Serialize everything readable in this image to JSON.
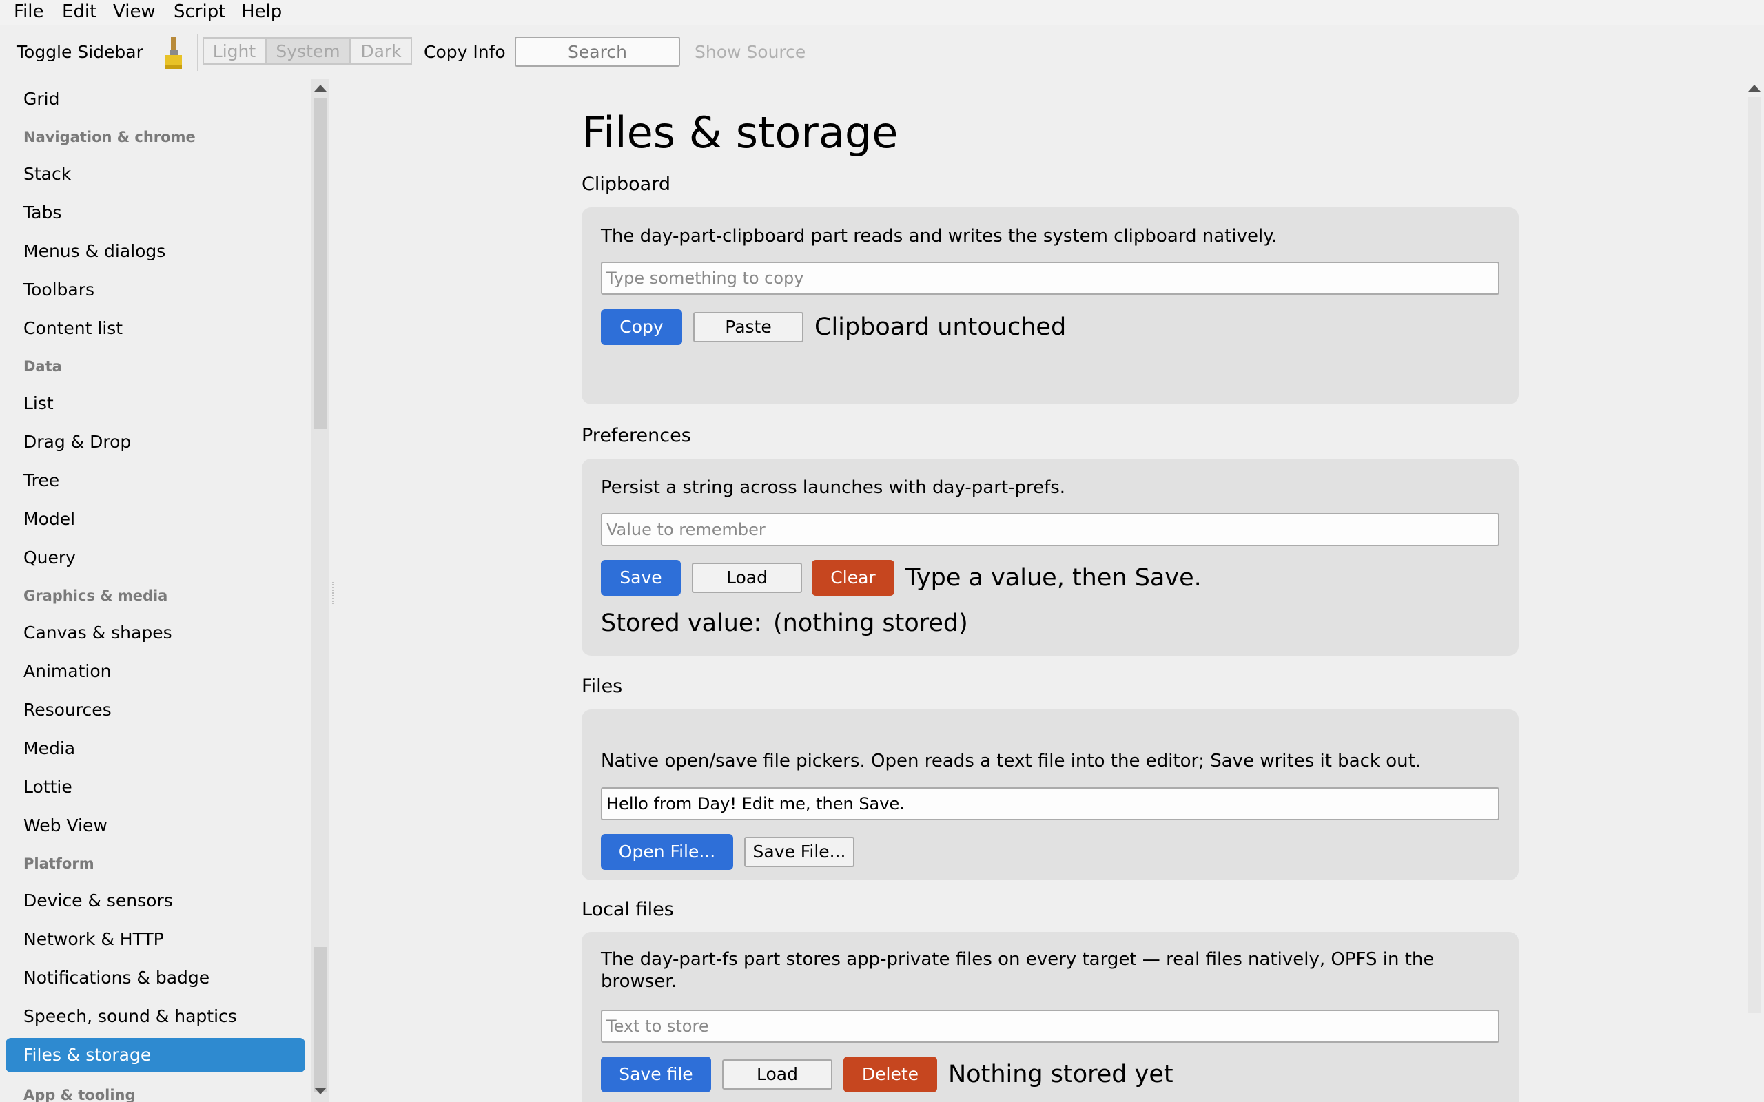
{
  "menubar": {
    "items": [
      "File",
      "Edit",
      "View",
      "Script",
      "Help"
    ]
  },
  "toolbar": {
    "toggle_sidebar": "Toggle Sidebar",
    "theme_light": "Light",
    "theme_system": "System",
    "theme_dark": "Dark",
    "copy_info": "Copy Info",
    "search_placeholder": "Search",
    "show_source": "Show Source"
  },
  "sidebar": {
    "items": [
      "Grid",
      "Stack",
      "Tabs",
      "Menus & dialogs",
      "Toolbars",
      "Content list",
      "List",
      "Drag & Drop",
      "Tree",
      "Model",
      "Query",
      "Canvas & shapes",
      "Animation",
      "Resources",
      "Media",
      "Lottie",
      "Web View",
      "Device & sensors",
      "Network & HTTP",
      "Notifications & badge",
      "Speech, sound & haptics",
      "Files & storage"
    ],
    "headers": [
      "Navigation & chrome",
      "Data",
      "Graphics & media",
      "Platform",
      "App & tooling"
    ],
    "selected": "Files & storage"
  },
  "page": {
    "title": "Files & storage"
  },
  "clipboard": {
    "title": "Clipboard",
    "description": "The day-part-clipboard part reads and writes the system clipboard natively.",
    "input_placeholder": "Type something to copy",
    "copy_label": "Copy",
    "paste_label": "Paste",
    "status": "Clipboard untouched"
  },
  "preferences": {
    "title": "Preferences",
    "description": "Persist a string across launches with day-part-prefs.",
    "input_placeholder": "Value to remember",
    "save_label": "Save",
    "load_label": "Load",
    "clear_label": "Clear",
    "status": "Type a value, then Save.",
    "stored_label": "Stored value:",
    "stored_value": "(nothing stored)"
  },
  "files": {
    "title": "Files",
    "description": "Native open/save file pickers. Open reads a text file into the editor; Save writes it back out.",
    "editor_value": "Hello from Day! Edit me, then Save.",
    "open_label": "Open File...",
    "save_label": "Save File..."
  },
  "local_files": {
    "title": "Local files",
    "description": "The day-part-fs part stores app-private files on every target — real files natively, OPFS in the browser.",
    "input_placeholder": "Text to store",
    "save_label": "Save file",
    "load_label": "Load",
    "delete_label": "Delete",
    "status": "Nothing stored yet"
  },
  "colors": {
    "primary": "#2e6fd8",
    "danger": "#c6461f",
    "selected": "#2e8ad0"
  },
  "icons": {
    "toolbar_theme": "paintbrush-icon"
  }
}
